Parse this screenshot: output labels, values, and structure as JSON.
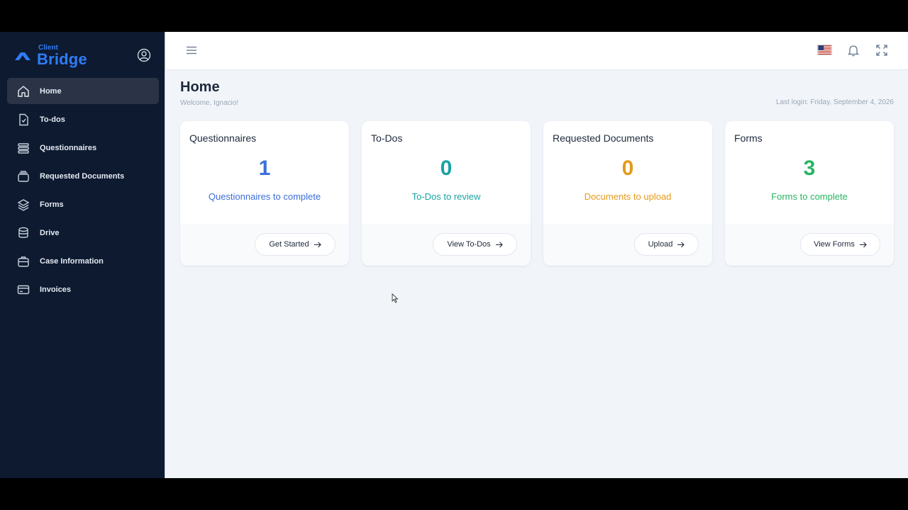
{
  "brand": {
    "small": "Client",
    "big": "Bridge",
    "accent": "#2f7cf6"
  },
  "sidebar": {
    "items": [
      {
        "label": "Home",
        "icon": "home-icon",
        "active": true
      },
      {
        "label": "To-dos",
        "icon": "file-check-icon"
      },
      {
        "label": "Questionnaires",
        "icon": "list-icon"
      },
      {
        "label": "Requested Documents",
        "icon": "archive-icon"
      },
      {
        "label": "Forms",
        "icon": "layers-icon"
      },
      {
        "label": "Drive",
        "icon": "database-icon"
      },
      {
        "label": "Case Information",
        "icon": "briefcase-icon"
      },
      {
        "label": "Invoices",
        "icon": "credit-card-icon"
      }
    ]
  },
  "page": {
    "title": "Home",
    "welcome": "Welcome, Ignacio!",
    "last_login": "Last login: Friday, September 4, 2026"
  },
  "cards": [
    {
      "title": "Questionnaires",
      "count": "1",
      "subtitle": "Questionnaires to complete",
      "button": "Get Started",
      "color": "#3b6fd8"
    },
    {
      "title": "To-Dos",
      "count": "0",
      "subtitle": "To-Dos to review",
      "button": "View To-Dos",
      "color": "#1aa3a3"
    },
    {
      "title": "Requested Documents",
      "count": "0",
      "subtitle": "Documents to upload",
      "button": "Upload",
      "color": "#e69a19"
    },
    {
      "title": "Forms",
      "count": "3",
      "subtitle": "Forms to complete",
      "button": "View Forms",
      "color": "#28b463"
    }
  ]
}
